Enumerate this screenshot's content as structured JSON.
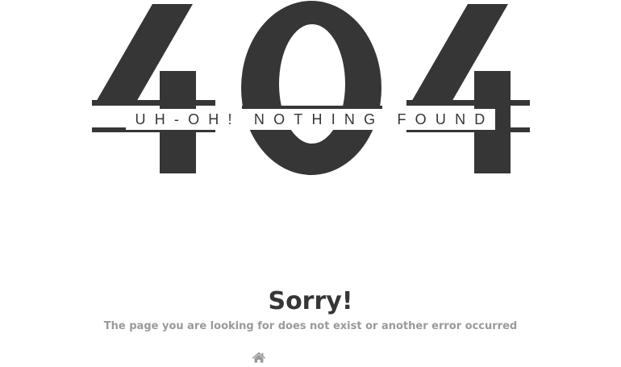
{
  "hero": {
    "code": "404",
    "tagline": "UH-OH! NOTHING FOUND"
  },
  "error": {
    "heading": "Sorry!",
    "message": "The page you are looking for does not exist or another error occurred"
  },
  "nav": {
    "home_icon": "home-icon"
  },
  "colors": {
    "text_dark": "#363636",
    "text_muted": "#9a9a9a",
    "background": "#ffffff"
  }
}
